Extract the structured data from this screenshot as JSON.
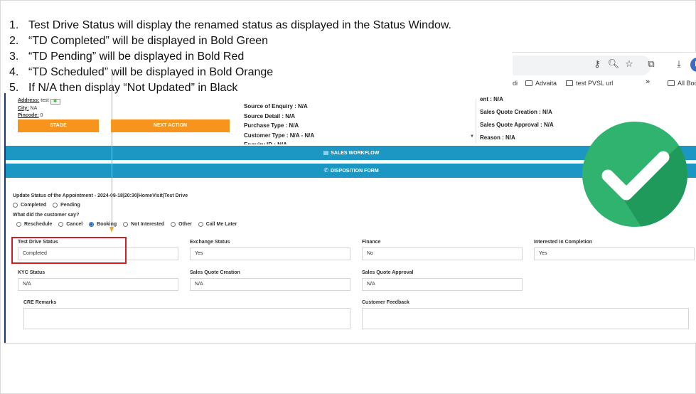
{
  "instructions": [
    {
      "num": "1.",
      "text": "Test Drive Status will display the renamed status as displayed in the Status Window."
    },
    {
      "num": "2.",
      "text": "“TD Completed” will be displayed in Bold Green"
    },
    {
      "num": "3.",
      "text": "“TD Pending” will be displayed in Bold Red"
    },
    {
      "num": "4.",
      "text": "“TD Scheduled” will be displayed in Bold Orange"
    },
    {
      "num": "5.",
      "text": "If N/A then display “Not Updated” in Black"
    }
  ],
  "browser": {
    "avatar_letter": "N",
    "bookmarks": {
      "partial": "di",
      "b1": "Advaita",
      "b2": "test PVSL url",
      "overflow": "»",
      "b3": "All Boo"
    }
  },
  "info": {
    "address_label": "Address:",
    "address_value": "test",
    "city_label": "City:",
    "city_value": "NA",
    "pincode_label": "Pincode:",
    "pincode_value": "0",
    "stage_btn": "STAGE",
    "next_btn": "NEXT ACTION",
    "mid_lines": [
      "Source of Enquiry : N/A",
      "Source Detail : N/A",
      "Purchase Type : N/A",
      "Customer Type : N/A - N/A",
      "Enquiry ID : N/A"
    ],
    "right_lines": [
      "ent : N/A",
      "Sales Quote Creation : N/A",
      "Sales Quote Approval : N/A",
      "Reason : N/A"
    ]
  },
  "bands": {
    "sales_workflow": "SALES WORKFLOW",
    "disposition_form": "DISPOSITION FORM"
  },
  "form": {
    "appointment_title": "Update Status of the Appointment - 2024-09-18|20:30|HomeVisit|Test Drive",
    "status_options": [
      {
        "label": "Completed",
        "checked": false
      },
      {
        "label": "Pending",
        "checked": false
      }
    ],
    "say_question": "What did the customer say?",
    "say_options": [
      {
        "label": "Reschedule",
        "checked": false
      },
      {
        "label": "Cancel",
        "checked": false
      },
      {
        "label": "Booking",
        "checked": true
      },
      {
        "label": "Not Interested",
        "checked": false
      },
      {
        "label": "Other",
        "checked": false
      },
      {
        "label": "Call Me Later",
        "checked": false
      }
    ],
    "fields": {
      "test_drive_status": {
        "label": "Test Drive Status",
        "value": "Completed"
      },
      "exchange_status": {
        "label": "Exchange Status",
        "value": "Yes"
      },
      "finance": {
        "label": "Finance",
        "value": "No"
      },
      "interested_in_completion": {
        "label": "Interested In Completion",
        "value": "Yes"
      },
      "kyc_status": {
        "label": "KYC Status",
        "value": "N/A"
      },
      "sales_quote_creation": {
        "label": "Sales Quote Creation",
        "value": "N/A"
      },
      "sales_quote_approval": {
        "label": "Sales Quote Approval",
        "value": "N/A"
      },
      "cre_remarks": {
        "label": "CRE Remarks",
        "value": ""
      },
      "customer_feedback": {
        "label": "Customer Feedback",
        "value": ""
      }
    }
  },
  "colors": {
    "band": "#1c97c4",
    "button_orange": "#f7941d",
    "highlight_red": "#d21f26",
    "arrow_orange": "#f5a623",
    "check_green": "#2fb36f"
  }
}
